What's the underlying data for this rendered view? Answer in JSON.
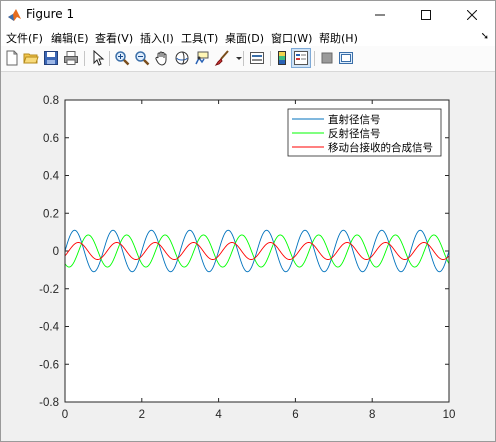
{
  "window": {
    "title": "Figure 1"
  },
  "menu": [
    {
      "label": "文件(F)",
      "name": "menu-file"
    },
    {
      "label": "编辑(E)",
      "name": "menu-edit"
    },
    {
      "label": "查看(V)",
      "name": "menu-view"
    },
    {
      "label": "插入(I)",
      "name": "menu-insert"
    },
    {
      "label": "工具(T)",
      "name": "menu-tools"
    },
    {
      "label": "桌面(D)",
      "name": "menu-desktop"
    },
    {
      "label": "窗口(W)",
      "name": "menu-window"
    },
    {
      "label": "帮助(H)",
      "name": "menu-help"
    }
  ],
  "toolbar": [
    "new-figure-icon",
    "open-file-icon",
    "save-icon",
    "print-icon",
    "pointer-icon",
    "zoom-in-icon",
    "zoom-out-icon",
    "pan-hand-icon",
    "rotate-3d-icon",
    "data-cursor-icon",
    "brush-icon",
    "brush-dropdown-icon",
    "link-plot-icon",
    "colorbar-icon",
    "legend-icon",
    "hide-plot-tools-icon",
    "show-plot-tools-icon"
  ],
  "colors": {
    "series1": "#0072bd",
    "series2": "#00ff00",
    "series3": "#ff0000"
  },
  "chart_data": {
    "type": "line",
    "title": "",
    "xlabel": "",
    "ylabel": "",
    "xlim": [
      0,
      10
    ],
    "ylim": [
      -0.8,
      0.8
    ],
    "xticks": [
      0,
      2,
      4,
      6,
      8,
      10
    ],
    "yticks": [
      -0.8,
      -0.6,
      -0.4,
      -0.2,
      0,
      0.2,
      0.4,
      0.6,
      0.8
    ],
    "xtick_labels": [
      "0",
      "2",
      "4",
      "6",
      "8",
      "10"
    ],
    "ytick_labels": [
      "-0.8",
      "-0.6",
      "-0.4",
      "-0.2",
      "0",
      "0.2",
      "0.4",
      "0.6",
      "0.8"
    ],
    "grid": false,
    "legend_position": "top-right",
    "series": [
      {
        "name": "直射径信号",
        "color": "#0072bd",
        "formula": "0.11*sin(2*pi*t)",
        "amplitude": 0.11,
        "frequency": 1.0,
        "phase_deg": 0
      },
      {
        "name": "反射径信号",
        "color": "#00ff00",
        "formula": "0.085*sin(2*pi*t - 2.24)",
        "amplitude": 0.085,
        "frequency": 1.0,
        "phase_deg": -128
      },
      {
        "name": "移动台接收的合成信号",
        "color": "#ff0000",
        "formula": "0.11*sin(2*pi*t) + 0.085*sin(2*pi*t - 2.24)",
        "amplitude": 0.045,
        "frequency": 1.0,
        "phase_deg": -35
      }
    ]
  }
}
